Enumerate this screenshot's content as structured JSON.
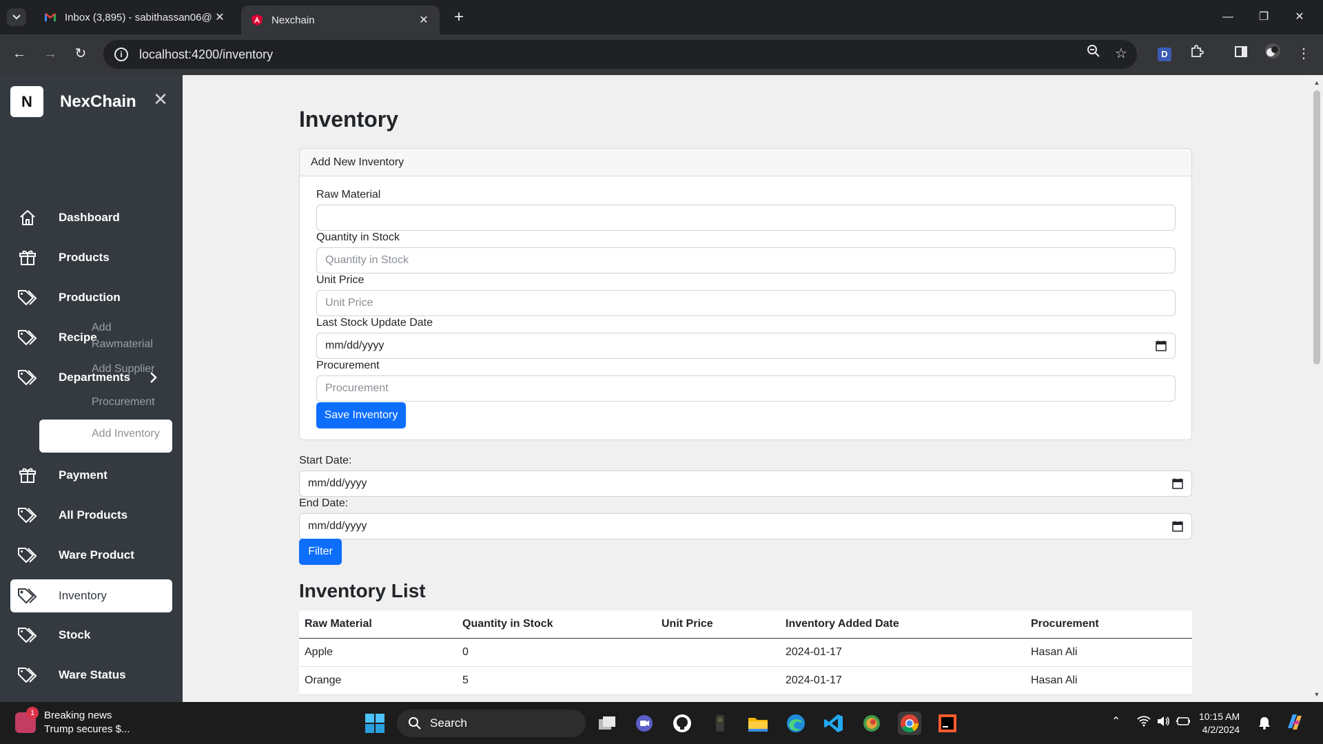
{
  "browser": {
    "tabs": [
      {
        "title": "Inbox (3,895) - sabithassan06@",
        "icon": "gmail-icon",
        "active": false
      },
      {
        "title": "Nexchain",
        "icon": "angular-icon",
        "active": true
      }
    ],
    "url": "localhost:4200/inventory"
  },
  "sidebar": {
    "brand_letter": "N",
    "brand_name": "NexChain",
    "items": [
      {
        "label": "Dashboard",
        "icon": "home-icon"
      },
      {
        "label": "Products",
        "icon": "box-icon"
      },
      {
        "label": "Production",
        "icon": "tag-icon"
      },
      {
        "label": "Recipe",
        "icon": "tag-icon"
      },
      {
        "label": "Departments",
        "icon": "tag-icon",
        "expanded": true
      },
      {
        "label": "Payment",
        "icon": "box-icon"
      },
      {
        "label": "All Products",
        "icon": "tag-icon"
      },
      {
        "label": "Ware Product",
        "icon": "tag-icon"
      },
      {
        "label": "Inventory",
        "icon": "tag-icon",
        "active": true
      },
      {
        "label": "Stock",
        "icon": "tag-icon"
      },
      {
        "label": "Ware Status",
        "icon": "tag-icon"
      }
    ],
    "sub_items": [
      {
        "label_line1": "Add",
        "label_line2": "Rawmaterial"
      },
      {
        "label": "Add Supplier"
      },
      {
        "label": "Procurement"
      },
      {
        "label": "Add Inventory",
        "active": true
      }
    ]
  },
  "page": {
    "title": "Inventory",
    "form": {
      "header": "Add New Inventory",
      "fields": [
        {
          "label": "Raw Material",
          "value": "",
          "placeholder": ""
        },
        {
          "label": "Quantity in Stock",
          "placeholder": "Quantity in Stock"
        },
        {
          "label": "Unit Price",
          "placeholder": "Unit Price"
        },
        {
          "label": "Last Stock Update Date",
          "placeholder": "mm/dd/yyyy"
        },
        {
          "label": "Procurement",
          "placeholder": "Procurement"
        }
      ],
      "save_label": "Save Inventory"
    },
    "filter": {
      "start_label": "Start Date:",
      "start_placeholder": "mm/dd/yyyy",
      "end_label": "End Date:",
      "end_placeholder": "mm/dd/yyyy",
      "button_label": "Filter"
    },
    "list": {
      "title": "Inventory List",
      "columns": [
        "Raw Material",
        "Quantity in Stock",
        "Unit Price",
        "Inventory Added Date",
        "Procurement"
      ],
      "rows": [
        [
          "Apple",
          "0",
          "",
          "2024-01-17",
          "Hasan Ali"
        ],
        [
          "Orange",
          "5",
          "",
          "2024-01-17",
          "Hasan Ali"
        ]
      ]
    }
  },
  "taskbar": {
    "news_badge": "1",
    "news_title": "Breaking news",
    "news_subtitle": "Trump secures $...",
    "search_label": "Search",
    "time": "10:15 AM",
    "date": "4/2/2024"
  },
  "colors": {
    "sidebar_bg": "#343a40",
    "primary": "#0d6efd"
  }
}
